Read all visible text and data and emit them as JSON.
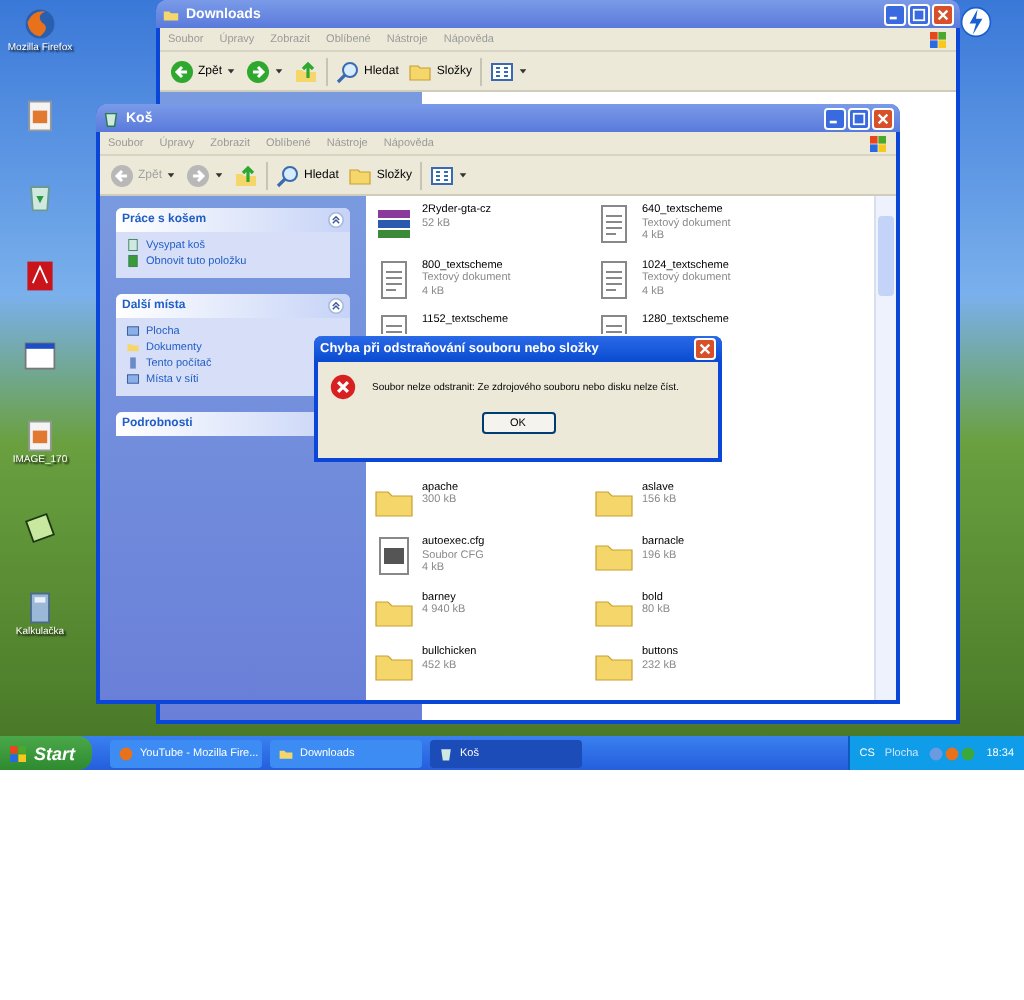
{
  "desktop": {
    "icons": [
      {
        "kind": "firefox",
        "label": "Mozilla Firefox"
      },
      {
        "kind": "image"
      },
      {
        "kind": "recycle"
      },
      {
        "kind": "pdf"
      },
      {
        "kind": "window"
      },
      {
        "kind": "image",
        "label": "IMAGE_170"
      },
      {
        "kind": "app"
      },
      {
        "kind": "calc",
        "label": "Kalkulačka"
      }
    ]
  },
  "windows": [
    {
      "kind": "downloads",
      "title": "Downloads",
      "menu": [
        "Soubor",
        "Úpravy",
        "Zobrazit",
        "Oblíbené",
        "Nástroje",
        "Nápověda"
      ],
      "toolbar": [
        {
          "kind": "back",
          "label": "Zpět",
          "disabled": false
        },
        {
          "kind": "forward",
          "disabled": false
        },
        {
          "kind": "up"
        },
        {
          "kind": "search",
          "label": "Hledat"
        },
        {
          "kind": "folders",
          "label": "Složky"
        },
        {
          "kind": "views"
        }
      ]
    },
    {
      "kind": "recycle",
      "title": "Koš",
      "menu": [
        "Soubor",
        "Úpravy",
        "Zobrazit",
        "Oblíbené",
        "Nástroje",
        "Nápověda"
      ],
      "toolbar": [
        {
          "kind": "back",
          "label": "Zpět",
          "disabled": true
        },
        {
          "kind": "forward",
          "disabled": true
        },
        {
          "kind": "up"
        },
        {
          "kind": "search",
          "label": "Hledat"
        },
        {
          "kind": "folders",
          "label": "Složky"
        },
        {
          "kind": "views"
        }
      ]
    }
  ],
  "task_panes": [
    {
      "title": "Práce s košem",
      "expanded": true,
      "items": [
        {
          "kind": "empty",
          "label": "Vysypat koš"
        },
        {
          "kind": "restore",
          "label": "Obnovit tuto položku"
        }
      ]
    },
    {
      "title": "Další místa",
      "expanded": true,
      "items": [
        {
          "kind": "desktop",
          "label": "Plocha"
        },
        {
          "kind": "documents",
          "label": "Dokumenty"
        },
        {
          "kind": "computer",
          "label": "Tento počítač"
        },
        {
          "kind": "network",
          "label": "Místa v síti"
        }
      ]
    },
    {
      "title": "Podrobnosti",
      "expanded": false
    }
  ],
  "files": [
    {
      "kind": "archive",
      "name": "2Ryder-gta-cz",
      "size": "52 kB"
    },
    {
      "kind": "text",
      "name": "640_textscheme",
      "type": "Textový dokument",
      "size": "4 kB"
    },
    {
      "kind": "text",
      "name": "800_textscheme",
      "type": "Textový dokument",
      "size": "4 kB"
    },
    {
      "kind": "text",
      "name": "1024_textscheme",
      "type": "Textový dokument",
      "size": "4 kB"
    },
    {
      "kind": "text",
      "name": "1152_textscheme"
    },
    {
      "kind": "text",
      "name": "1280_textscheme"
    }
  ],
  "files_below_dialog": [
    {
      "kind": "folder",
      "name": "apache",
      "size": "300 kB"
    },
    {
      "kind": "folder",
      "name": "aslave",
      "size": "156 kB"
    },
    {
      "kind": "cfg",
      "name": "autoexec.cfg",
      "type": "Soubor CFG",
      "size": "4 kB"
    },
    {
      "kind": "folder",
      "name": "barnacle",
      "size": "196 kB"
    },
    {
      "kind": "folder",
      "name": "barney",
      "size": "4 940 kB"
    },
    {
      "kind": "folder",
      "name": "bold",
      "size": "80 kB"
    },
    {
      "kind": "folder",
      "name": "bullchicken",
      "size": "452 kB"
    },
    {
      "kind": "folder",
      "name": "buttons",
      "size": "232 kB"
    }
  ],
  "dialog": {
    "title": "Chyba při odstraňování souboru nebo složky",
    "message": "Soubor nelze odstranit: Ze zdrojového souboru nebo disku nelze číst.",
    "button": "OK"
  },
  "taskbar": {
    "start": "Start",
    "buttons": [
      {
        "kind": "firefox",
        "label": "YouTube - Mozilla Fire...",
        "selected": false
      },
      {
        "kind": "folder",
        "label": "Downloads",
        "selected": false
      },
      {
        "kind": "recycle",
        "label": "Koš",
        "selected": true
      }
    ],
    "tray": {
      "language": "CS",
      "toolbar": "Plocha",
      "time": "18:34"
    }
  }
}
